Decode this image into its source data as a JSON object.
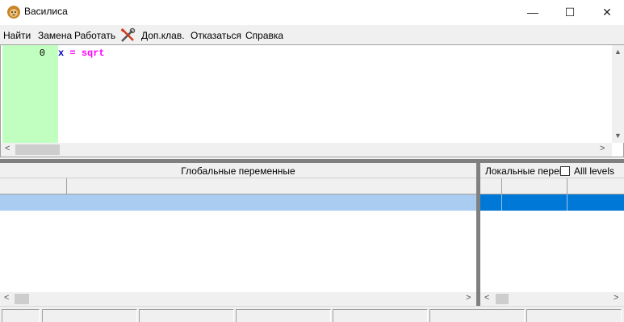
{
  "window": {
    "title": "Василиса",
    "icon": "lion-head-icon",
    "controls": {
      "minimize": "—",
      "maximize": "☐",
      "close": "✕"
    }
  },
  "menu": {
    "items": [
      "Найти",
      "Замена",
      "Работать",
      "Доп.клав.",
      "Отказаться",
      "Справка"
    ],
    "tools_icon": "tools-icon"
  },
  "editor": {
    "line_number": "0",
    "code": {
      "var": "x",
      "op": "=",
      "func": "sqrt"
    },
    "colors": {
      "gutter": "#c0ffc0",
      "variable": "#0000c0",
      "keyword": "#ff00ff"
    }
  },
  "globals": {
    "title": "Глобальные переменные",
    "selected_row_color": "#a9ccf0"
  },
  "locals": {
    "title": "Локальные переменные",
    "all_levels_label": "Alll levels",
    "all_levels_checked": false,
    "selected_row_color": "#0078d7"
  }
}
